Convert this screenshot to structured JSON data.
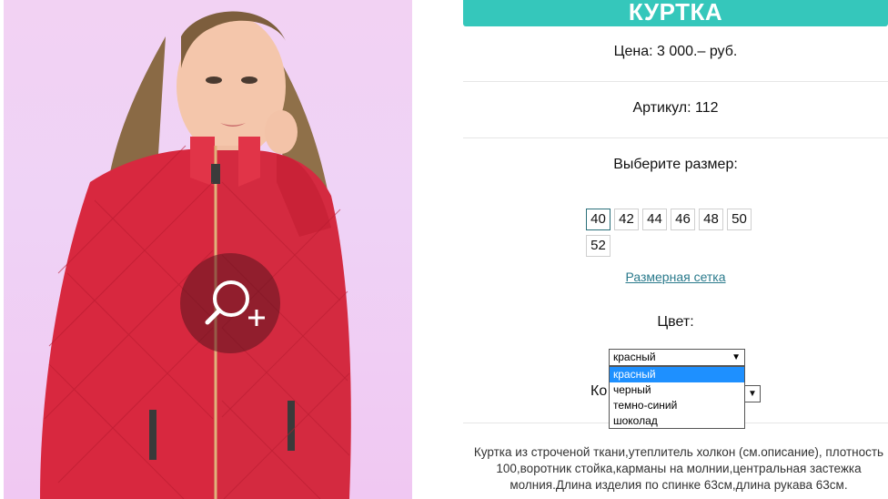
{
  "product": {
    "title": "КУРТКА",
    "price_text": "Цена: 3 000.– руб.",
    "article_text": "Артикул: 112",
    "choose_size_label": "Выберите размер:",
    "sizes": [
      "40",
      "42",
      "44",
      "46",
      "48",
      "50",
      "52"
    ],
    "selected_size": "40",
    "size_chart_link": "Размерная сетка",
    "color_label": "Цвет:",
    "color_selected": "красный",
    "color_options": [
      "красный",
      "черный",
      "темно-синий",
      "шоколад"
    ],
    "quantity_label_partial": "Ко",
    "description": "Куртка из строченой ткани,утеплитель холкон (см.описание), плотность 100,воротник стойка,карманы на молнии,центральная застежка молния.Длина изделия по спинке 63см,длина рукава 63см."
  },
  "colors": {
    "accent": "#35c7bb",
    "link": "#2a7a8c",
    "dropdown_highlight": "#1e90ff"
  },
  "icons": {
    "zoom": "zoom-in-icon"
  }
}
